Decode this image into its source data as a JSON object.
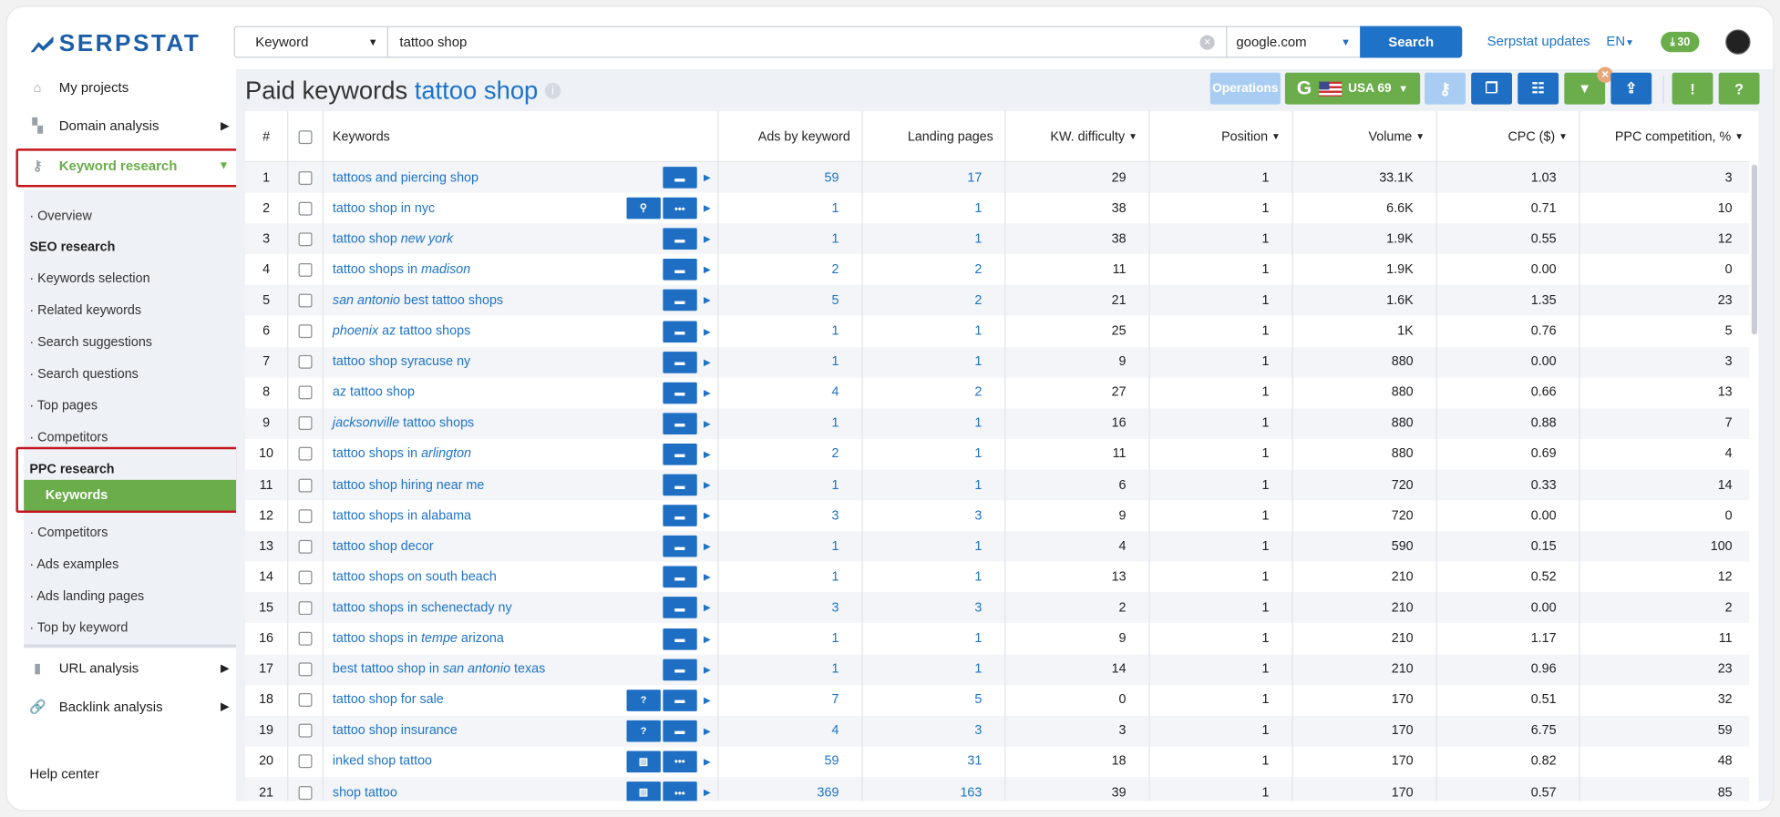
{
  "brand": {
    "logo": "SERPSTAT",
    "color": "#1c5ea8"
  },
  "search": {
    "type": "Keyword",
    "query": "tattoo shop",
    "database": "google.com",
    "button": "Search"
  },
  "top": {
    "updates": "Serpstat updates",
    "lang": "EN",
    "downloads": "30"
  },
  "sidebar": {
    "my_projects": "My projects",
    "domain_analysis": "Domain analysis",
    "keyword_research": "Keyword research",
    "overview": "Overview",
    "seo_heading": "SEO research",
    "seo_items": [
      "Keywords selection",
      "Related keywords",
      "Search suggestions",
      "Search questions",
      "Top pages",
      "Competitors"
    ],
    "ppc_heading": "PPC research",
    "ppc_active": "Keywords",
    "ppc_items": [
      "Competitors",
      "Ads examples",
      "Ads landing pages",
      "Top by keyword"
    ],
    "url_analysis": "URL analysis",
    "backlink_analysis": "Backlink analysis",
    "help": "Help center"
  },
  "page": {
    "title": "Paid keywords",
    "query": "tattoo shop"
  },
  "toolbar": {
    "operations": "Operations",
    "region": "USA 69",
    "engine": "G"
  },
  "colors": {
    "accent": "#1e73c8",
    "green": "#6aad4a",
    "highlight": "#c4161c"
  },
  "table": {
    "headers": [
      "#",
      "Keywords",
      "Ads by keyword",
      "Landing pages",
      "KW. difficulty",
      "Position",
      "Volume",
      "CPC ($)",
      "PPC competition, %"
    ],
    "rows": [
      {
        "n": "1",
        "kw": [
          {
            "t": "tattoos and piercing shop"
          }
        ],
        "icons": [
          "ads"
        ],
        "ads": "59",
        "lp": "17",
        "kd": "29",
        "pos": "1",
        "vol": "33.1K",
        "cpc": "1.03",
        "comp": "3"
      },
      {
        "n": "2",
        "kw": [
          {
            "t": "tattoo shop in nyc"
          }
        ],
        "icons": [
          "local",
          "more"
        ],
        "ads": "1",
        "lp": "1",
        "kd": "38",
        "pos": "1",
        "vol": "6.6K",
        "cpc": "0.71",
        "comp": "10"
      },
      {
        "n": "3",
        "kw": [
          {
            "t": "tattoo shop "
          },
          {
            "t": "new york",
            "i": true
          }
        ],
        "icons": [
          "ads"
        ],
        "ads": "1",
        "lp": "1",
        "kd": "38",
        "pos": "1",
        "vol": "1.9K",
        "cpc": "0.55",
        "comp": "12"
      },
      {
        "n": "4",
        "kw": [
          {
            "t": "tattoo shops in "
          },
          {
            "t": "madison",
            "i": true
          }
        ],
        "icons": [
          "ads"
        ],
        "ads": "2",
        "lp": "2",
        "kd": "11",
        "pos": "1",
        "vol": "1.9K",
        "cpc": "0.00",
        "comp": "0"
      },
      {
        "n": "5",
        "kw": [
          {
            "t": "san antonio",
            "i": true
          },
          {
            "t": " best tattoo shops"
          }
        ],
        "icons": [
          "ads"
        ],
        "ads": "5",
        "lp": "2",
        "kd": "21",
        "pos": "1",
        "vol": "1.6K",
        "cpc": "1.35",
        "comp": "23"
      },
      {
        "n": "6",
        "kw": [
          {
            "t": "phoenix",
            "i": true
          },
          {
            "t": " az tattoo shops"
          }
        ],
        "icons": [
          "ads"
        ],
        "ads": "1",
        "lp": "1",
        "kd": "25",
        "pos": "1",
        "vol": "1K",
        "cpc": "0.76",
        "comp": "5"
      },
      {
        "n": "7",
        "kw": [
          {
            "t": "tattoo shop syracuse ny"
          }
        ],
        "icons": [
          "ads"
        ],
        "ads": "1",
        "lp": "1",
        "kd": "9",
        "pos": "1",
        "vol": "880",
        "cpc": "0.00",
        "comp": "3"
      },
      {
        "n": "8",
        "kw": [
          {
            "t": "az tattoo shop"
          }
        ],
        "icons": [
          "ads"
        ],
        "ads": "4",
        "lp": "2",
        "kd": "27",
        "pos": "1",
        "vol": "880",
        "cpc": "0.66",
        "comp": "13"
      },
      {
        "n": "9",
        "kw": [
          {
            "t": "jacksonville",
            "i": true
          },
          {
            "t": " tattoo shops"
          }
        ],
        "icons": [
          "ads"
        ],
        "ads": "1",
        "lp": "1",
        "kd": "16",
        "pos": "1",
        "vol": "880",
        "cpc": "0.88",
        "comp": "7"
      },
      {
        "n": "10",
        "kw": [
          {
            "t": "tattoo shops in "
          },
          {
            "t": "arlington",
            "i": true
          }
        ],
        "icons": [
          "ads"
        ],
        "ads": "2",
        "lp": "1",
        "kd": "11",
        "pos": "1",
        "vol": "880",
        "cpc": "0.69",
        "comp": "4"
      },
      {
        "n": "11",
        "kw": [
          {
            "t": "tattoo shop hiring near me"
          }
        ],
        "icons": [
          "ads"
        ],
        "ads": "1",
        "lp": "1",
        "kd": "6",
        "pos": "1",
        "vol": "720",
        "cpc": "0.33",
        "comp": "14"
      },
      {
        "n": "12",
        "kw": [
          {
            "t": "tattoo shops in alabama"
          }
        ],
        "icons": [
          "ads"
        ],
        "ads": "3",
        "lp": "3",
        "kd": "9",
        "pos": "1",
        "vol": "720",
        "cpc": "0.00",
        "comp": "0"
      },
      {
        "n": "13",
        "kw": [
          {
            "t": "tattoo shop decor"
          }
        ],
        "icons": [
          "ads"
        ],
        "ads": "1",
        "lp": "1",
        "kd": "4",
        "pos": "1",
        "vol": "590",
        "cpc": "0.15",
        "comp": "100"
      },
      {
        "n": "14",
        "kw": [
          {
            "t": "tattoo shops on south beach"
          }
        ],
        "icons": [
          "ads"
        ],
        "ads": "1",
        "lp": "1",
        "kd": "13",
        "pos": "1",
        "vol": "210",
        "cpc": "0.52",
        "comp": "12"
      },
      {
        "n": "15",
        "kw": [
          {
            "t": "tattoo shops in schenectady ny"
          }
        ],
        "icons": [
          "ads"
        ],
        "ads": "3",
        "lp": "3",
        "kd": "2",
        "pos": "1",
        "vol": "210",
        "cpc": "0.00",
        "comp": "2"
      },
      {
        "n": "16",
        "kw": [
          {
            "t": "tattoo shops in "
          },
          {
            "t": "tempe",
            "i": true
          },
          {
            "t": " arizona"
          }
        ],
        "icons": [
          "ads"
        ],
        "ads": "1",
        "lp": "1",
        "kd": "9",
        "pos": "1",
        "vol": "210",
        "cpc": "1.17",
        "comp": "11"
      },
      {
        "n": "17",
        "kw": [
          {
            "t": "best tattoo shop in "
          },
          {
            "t": "san antonio",
            "i": true
          },
          {
            "t": " texas"
          }
        ],
        "icons": [
          "ads"
        ],
        "ads": "1",
        "lp": "1",
        "kd": "14",
        "pos": "1",
        "vol": "210",
        "cpc": "0.96",
        "comp": "23"
      },
      {
        "n": "18",
        "kw": [
          {
            "t": "tattoo shop for sale"
          }
        ],
        "icons": [
          "question",
          "ads"
        ],
        "ads": "7",
        "lp": "5",
        "kd": "0",
        "pos": "1",
        "vol": "170",
        "cpc": "0.51",
        "comp": "32"
      },
      {
        "n": "19",
        "kw": [
          {
            "t": "tattoo shop insurance"
          }
        ],
        "icons": [
          "question",
          "ads"
        ],
        "ads": "4",
        "lp": "3",
        "kd": "3",
        "pos": "1",
        "vol": "170",
        "cpc": "6.75",
        "comp": "59"
      },
      {
        "n": "20",
        "kw": [
          {
            "t": "inked shop tattoo"
          }
        ],
        "icons": [
          "image",
          "more"
        ],
        "ads": "59",
        "lp": "31",
        "kd": "18",
        "pos": "1",
        "vol": "170",
        "cpc": "0.82",
        "comp": "48"
      },
      {
        "n": "21",
        "kw": [
          {
            "t": "shop tattoo"
          }
        ],
        "icons": [
          "image",
          "more"
        ],
        "ads": "369",
        "lp": "163",
        "kd": "39",
        "pos": "1",
        "vol": "170",
        "cpc": "0.57",
        "comp": "85"
      }
    ]
  }
}
